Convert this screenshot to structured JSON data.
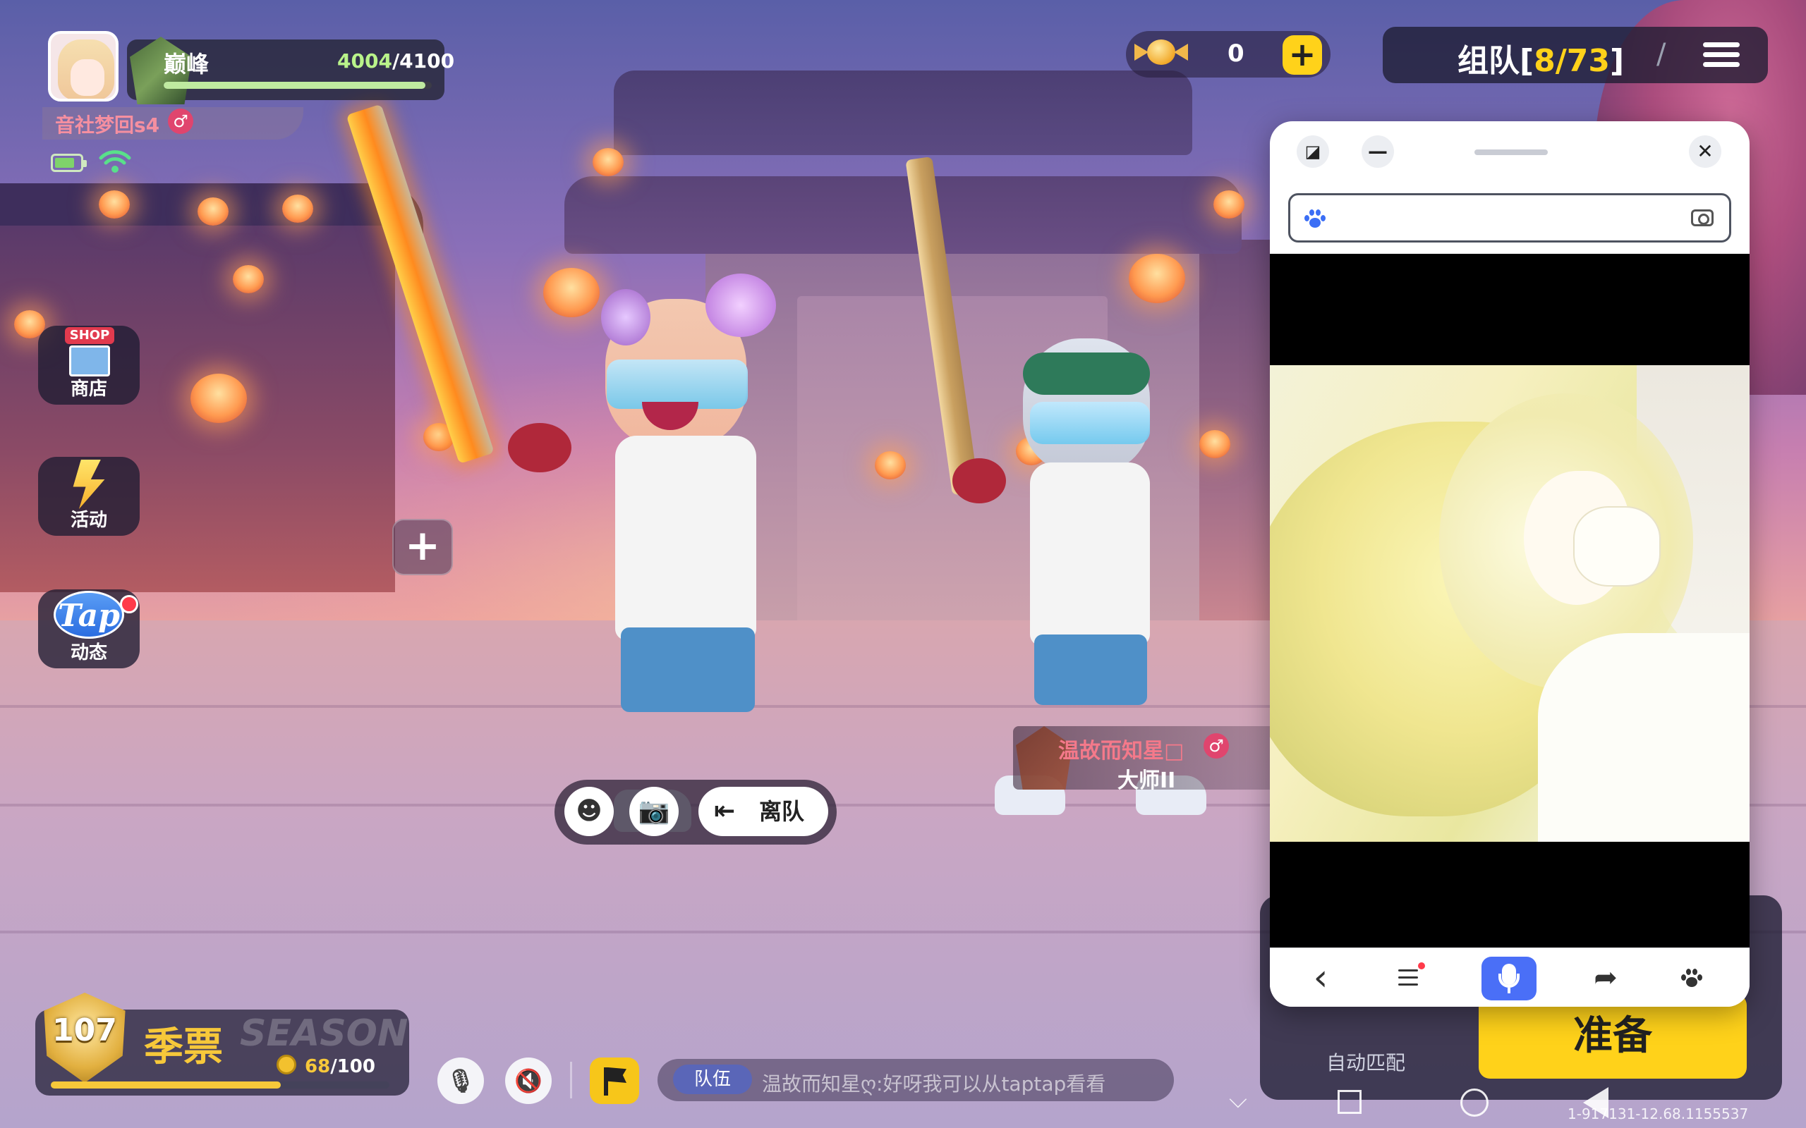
{
  "player": {
    "rank_name": "巅峰",
    "xp_current": "4004",
    "xp_sep_max": "/4100",
    "xp_fraction": 0.977,
    "name": "音社梦回s4",
    "gender_symbol": "♂",
    "avatar_icon": "anime-girl-avatar"
  },
  "status": {
    "battery_icon": "battery-icon",
    "battery_fraction": 0.8,
    "wifi_icon": "wifi-icon",
    "wifi_glyph": "📶"
  },
  "side_menu": {
    "shop": {
      "sign": "SHOP",
      "label": "商店"
    },
    "events": {
      "label": "活动"
    },
    "tap": {
      "logo": "Tap",
      "label": "动态"
    }
  },
  "add_slot": {
    "symbol": "+"
  },
  "currency": {
    "value": "0",
    "add_symbol": "+"
  },
  "team": {
    "prefix": "组队[",
    "count": "8/73",
    "suffix": "]",
    "slash": "/"
  },
  "season": {
    "level": "107",
    "title": "季票",
    "watermark": "SEASON",
    "progress_current": "68",
    "progress_max": "/100",
    "progress_fraction": 0.68
  },
  "bottom_bar": {
    "mic_glyph": "🎙",
    "speaker_glyph": "🔇",
    "chat_tag": "队伍",
    "chat_message": "温故而知星ღ:好呀我可以从taptap看看"
  },
  "action_bar": {
    "emote_glyph": "☻",
    "camera_glyph": "📷",
    "leave_label": "离队"
  },
  "teammate": {
    "name": "温故而知星□",
    "gender_symbol": "♂",
    "rank": "大师II"
  },
  "match": {
    "auto_label": "自动匹配",
    "ready_label": "准备"
  },
  "android_nav": {
    "chevron": "⌵",
    "build": "1-917131-12.68.1155537"
  },
  "popup": {
    "close_symbol": "✕",
    "minimize_symbol": "—",
    "resize_symbol": "◪",
    "search_placeholder": "",
    "bottom_nav": {
      "back_glyph": "‹",
      "share_glyph": "➦"
    }
  },
  "colors": {
    "accent_yellow": "#ffd21a",
    "xp_green": "#b9f38a",
    "name_pink": "#f58fa0",
    "mic_blue": "#4a6ff7"
  }
}
